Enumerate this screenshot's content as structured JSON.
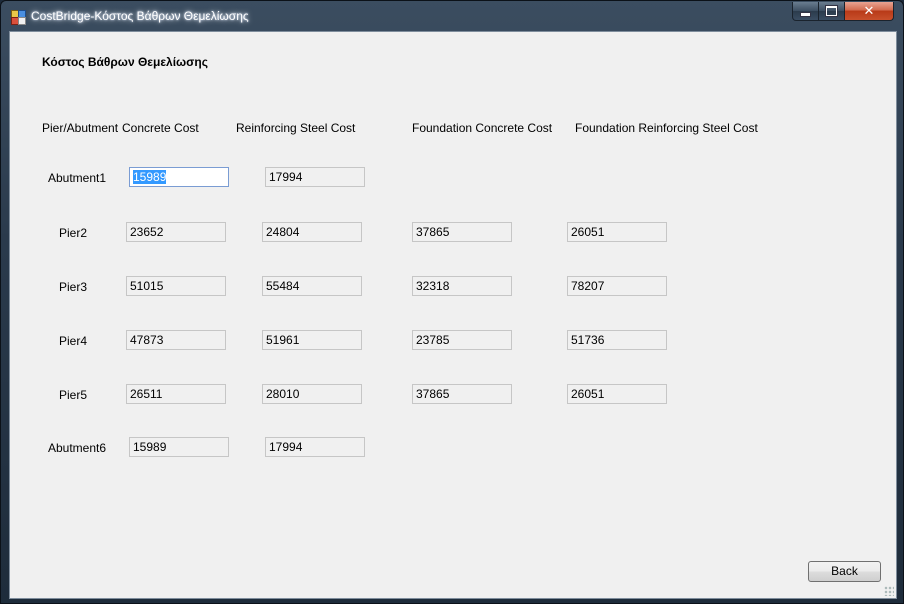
{
  "window": {
    "title": "CostBridge-Κόστος Βάθρων Θεμελίωσης",
    "controls": {
      "minimize": "minimize-icon",
      "maximize": "maximize-icon",
      "close": "✕"
    }
  },
  "form": {
    "heading": "Κόστος Βάθρων Θεμελίωσης",
    "columns": {
      "pier_abutment": "Pier/Abutment",
      "concrete_cost": "Concrete Cost",
      "reinforcing_steel_cost": "Reinforcing Steel Cost",
      "foundation_concrete_cost": "Foundation Concrete Cost",
      "foundation_reinforcing_steel_cost": "Foundation Reinforcing Steel Cost"
    },
    "rows": [
      {
        "label": "Abutment1",
        "concrete": "15989",
        "steel": "17994"
      },
      {
        "label": "Pier2",
        "concrete": "23652",
        "steel": "24804",
        "foundation_concrete": "37865",
        "foundation_steel": "26051"
      },
      {
        "label": "Pier3",
        "concrete": "51015",
        "steel": "55484",
        "foundation_concrete": "32318",
        "foundation_steel": "78207"
      },
      {
        "label": "Pier4",
        "concrete": "47873",
        "steel": "51961",
        "foundation_concrete": "23785",
        "foundation_steel": "51736"
      },
      {
        "label": "Pier5",
        "concrete": "26511",
        "steel": "28010",
        "foundation_concrete": "37865",
        "foundation_steel": "26051"
      },
      {
        "label": "Abutment6",
        "concrete": "15989",
        "steel": "17994"
      }
    ],
    "back_label": "Back"
  }
}
